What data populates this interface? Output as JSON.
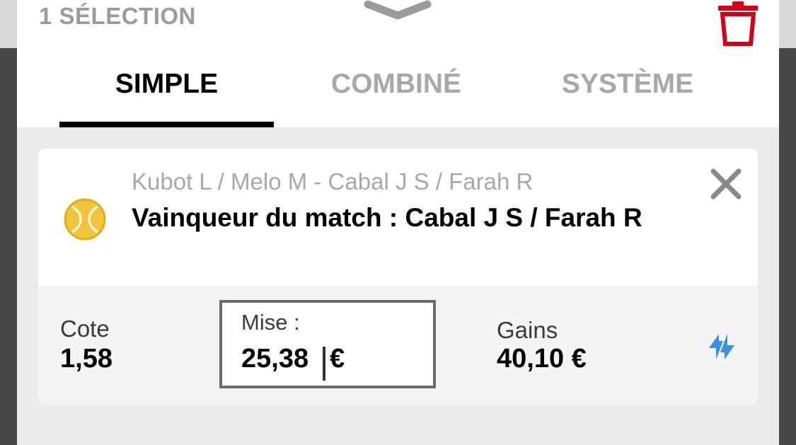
{
  "header": {
    "selection_count": "1 SÉLECTION",
    "collapse_icon": "chevron-down-icon",
    "delete_icon": "trash-icon"
  },
  "tabs": [
    {
      "label": "SIMPLE",
      "active": true
    },
    {
      "label": "COMBINÉ",
      "active": false
    },
    {
      "label": "SYSTÈME",
      "active": false
    }
  ],
  "bet": {
    "match": "Kubot L / Melo M - Cabal J S / Farah R",
    "label": "Vainqueur du match : Cabal J S / Farah R",
    "sport_icon": "tennis-ball-icon",
    "remove_icon": "close-icon",
    "odds_label": "Cote",
    "odds_value": "1,58",
    "stake_label": "Mise :",
    "stake_value": "25,38",
    "currency": "€",
    "gains_label": "Gains",
    "gains_value": "40,10 €",
    "swap_icon": "swap-icon"
  },
  "colors": {
    "accent_red": "#d0021b",
    "tennis_yellow": "#f0c43c",
    "swap_blue": "#3d8fe0"
  }
}
